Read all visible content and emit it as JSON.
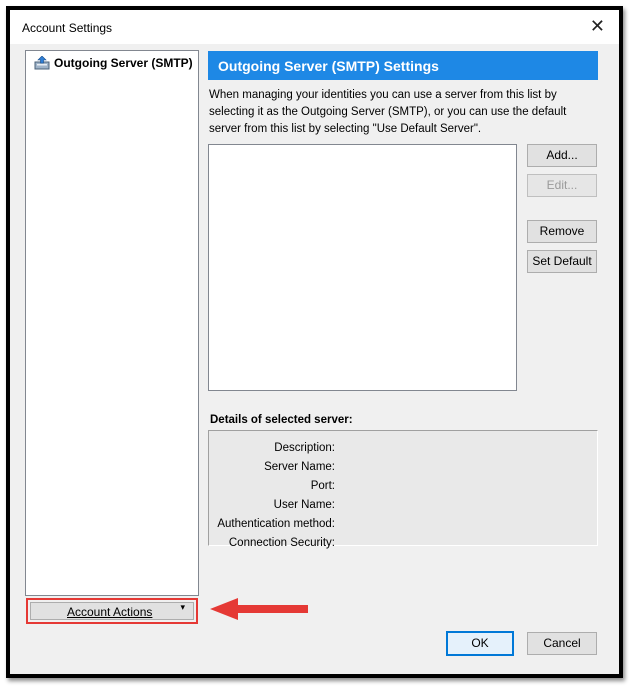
{
  "window": {
    "title": "Account Settings",
    "close_glyph": "✕"
  },
  "sidebar": {
    "items": [
      {
        "label": "Outgoing Server (SMTP)",
        "icon": "smtp-server-icon",
        "selected": true
      }
    ],
    "account_actions_label": "Account Actions",
    "account_actions_caret": "▾"
  },
  "main": {
    "header": "Outgoing Server (SMTP) Settings",
    "description": "When managing your identities you can use a server from this list by selecting it as the Outgoing Server (SMTP), or you can use the default server from this list by selecting \"Use Default Server\".",
    "server_list": [],
    "buttons": {
      "add": "Add...",
      "edit": "Edit...",
      "remove": "Remove",
      "set_default": "Set Default"
    },
    "details_title": "Details of selected server:",
    "details_fields": {
      "description": "Description:",
      "server_name": "Server Name:",
      "port": "Port:",
      "user_name": "User Name:",
      "auth_method": "Authentication method:",
      "connection_security": "Connection Security:"
    }
  },
  "footer": {
    "ok": "OK",
    "cancel": "Cancel"
  },
  "colors": {
    "header_blue": "#1e88e5",
    "highlight_red": "#e53935",
    "focus_blue": "#0078d7"
  }
}
